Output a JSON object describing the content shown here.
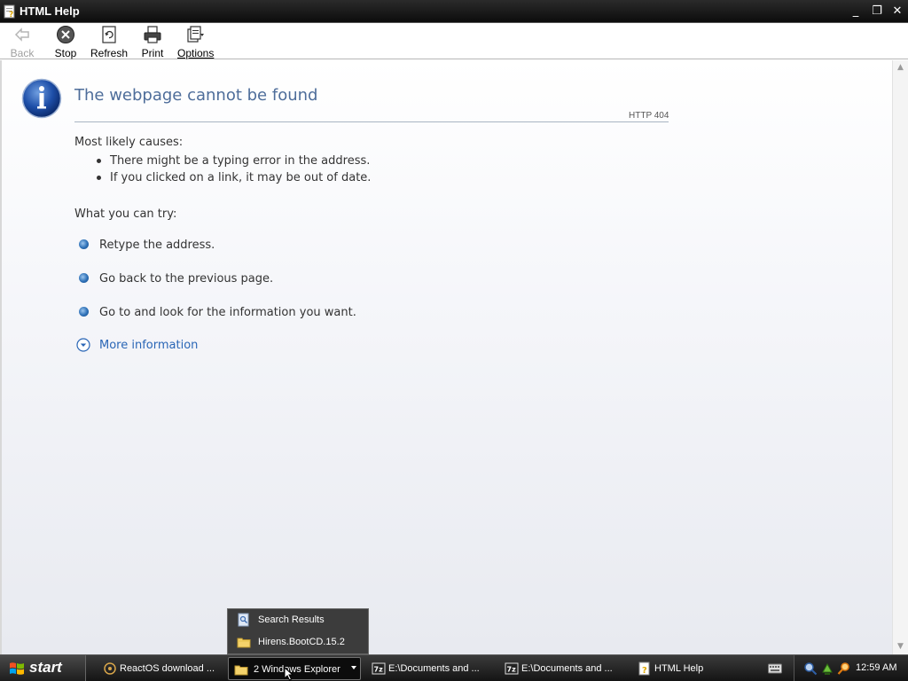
{
  "window": {
    "title": "HTML Help",
    "controls": {
      "minimize": "_",
      "maximize": "❐",
      "close": "✕"
    }
  },
  "toolbar": {
    "buttons": [
      {
        "label": "Back",
        "icon": "back-arrow-icon",
        "enabled": false
      },
      {
        "label": "Stop",
        "icon": "stop-icon",
        "enabled": true
      },
      {
        "label": "Refresh",
        "icon": "refresh-icon",
        "enabled": true
      },
      {
        "label": "Print",
        "icon": "printer-icon",
        "enabled": true
      },
      {
        "label": "Options",
        "icon": "options-icon",
        "enabled": true
      }
    ]
  },
  "error_page": {
    "title": "The webpage cannot be found",
    "status": "HTTP 404",
    "causes_heading": "Most likely causes:",
    "causes": [
      "There might be a typing error in the address.",
      "If you clicked on a link, it may be out of date."
    ],
    "try_heading": "What you can try:",
    "actions": [
      "Retype the address.",
      "Go back to the previous page.",
      "Go to  and look for the information you want."
    ],
    "more_info": "More information",
    "accent_color": "#4e6d9a",
    "link_color": "#2a66b6"
  },
  "popup_menu": {
    "items": [
      {
        "label": "Search Results",
        "icon": "search-results-icon"
      },
      {
        "label": "Hirens.BootCD.15.2",
        "icon": "folder-icon"
      }
    ]
  },
  "taskbar": {
    "start_label": "start",
    "tasks": [
      {
        "label": "ReactOS download ...",
        "icon": "browser-icon",
        "active": false
      },
      {
        "label": "2 Windows Explorer",
        "icon": "folder-icon",
        "active": true
      },
      {
        "label": "E:\\Documents and ...",
        "icon": "7zip-icon",
        "active": false
      },
      {
        "label": "E:\\Documents and ...",
        "icon": "7zip-icon",
        "active": false
      },
      {
        "label": "HTML Help",
        "icon": "help-icon",
        "active": false
      }
    ],
    "clock": "12:59 AM",
    "tray_icons": [
      "keyboard-icon",
      "magnifier-icon",
      "network-icon",
      "search-icon"
    ]
  }
}
